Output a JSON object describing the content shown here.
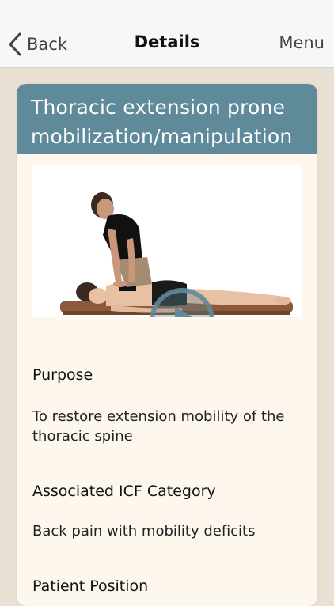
{
  "nav": {
    "back_label": "Back",
    "title": "Details",
    "menu_label": "Menu"
  },
  "card": {
    "title_line1": "Thoracic extension prone",
    "title_line2": "mobilization/manipulation",
    "header_color": "#5f8a99",
    "background_color": "#fdf7ee"
  },
  "sections": {
    "purpose_heading": "Purpose",
    "purpose_text": "To restore extension mobility of the thoracic spine",
    "icf_heading": "Associated ICF Category",
    "icf_text": "Back pain with mobility deficits",
    "position_heading": "Patient Position"
  },
  "icons": {
    "back": "chevron-left-icon",
    "play": "play-icon"
  }
}
